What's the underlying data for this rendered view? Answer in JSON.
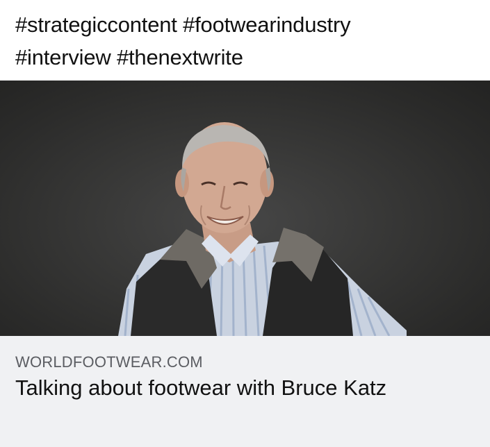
{
  "post": {
    "hashtags_line1": "#strategiccontent #footwearindustry",
    "hashtags_line2": "#interview #thenextwrite"
  },
  "link_preview": {
    "domain": "WORLDFOOTWEAR.COM",
    "title": "Talking about footwear with Bruce Katz"
  },
  "colors": {
    "photo_background": "#2f2f2e",
    "card_background": "#f0f1f3",
    "domain_text": "#5b5d62",
    "title_text": "#111111"
  }
}
